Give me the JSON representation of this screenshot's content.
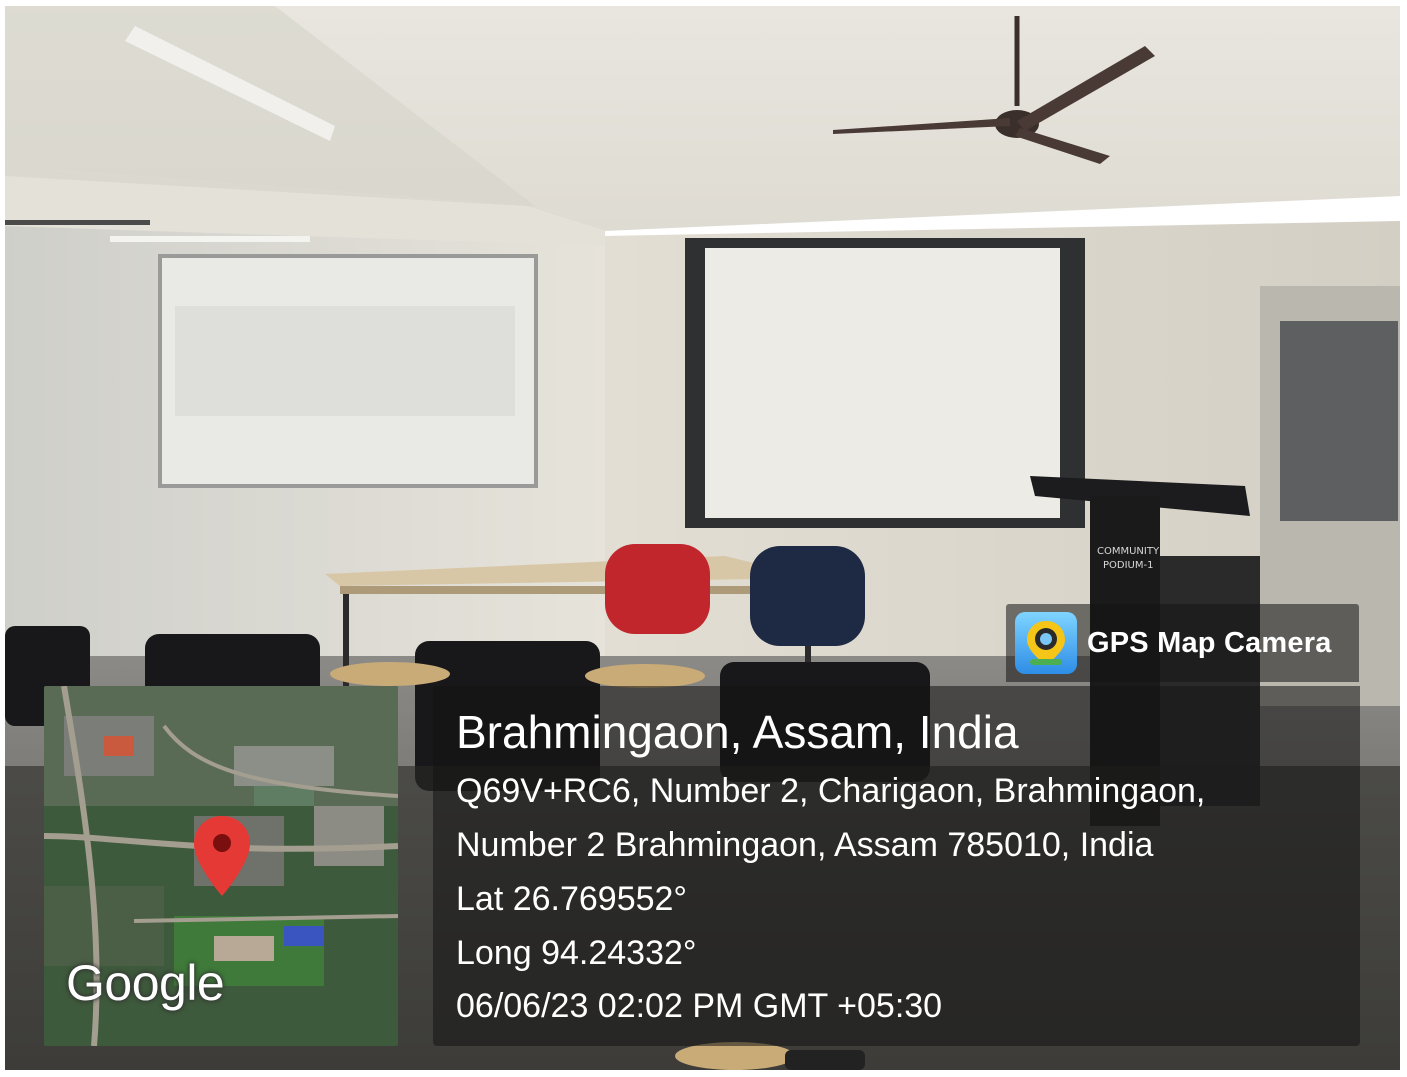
{
  "overlay": {
    "app_name": "GPS Map Camera",
    "icon": "camera-map-pin-icon",
    "title": "Brahmingaon, Assam, India",
    "address_line1": "Q69V+RC6, Number 2, Charigaon, Brahmingaon,",
    "address_line2": "Number 2 Brahmingaon, Assam 785010, India",
    "latitude": "Lat 26.769552°",
    "longitude": "Long 94.24332°",
    "datetime": "06/06/23 02:02 PM GMT +05:30"
  },
  "map": {
    "provider_wordmark": "Google",
    "pin_color": "#e53935"
  },
  "scene": {
    "podium_label": "COMMUNITY PODIUM-1",
    "colors": {
      "chair_red": "#c0262c",
      "chair_navy": "#1e2a44",
      "wall": "#d9d6cc"
    }
  }
}
